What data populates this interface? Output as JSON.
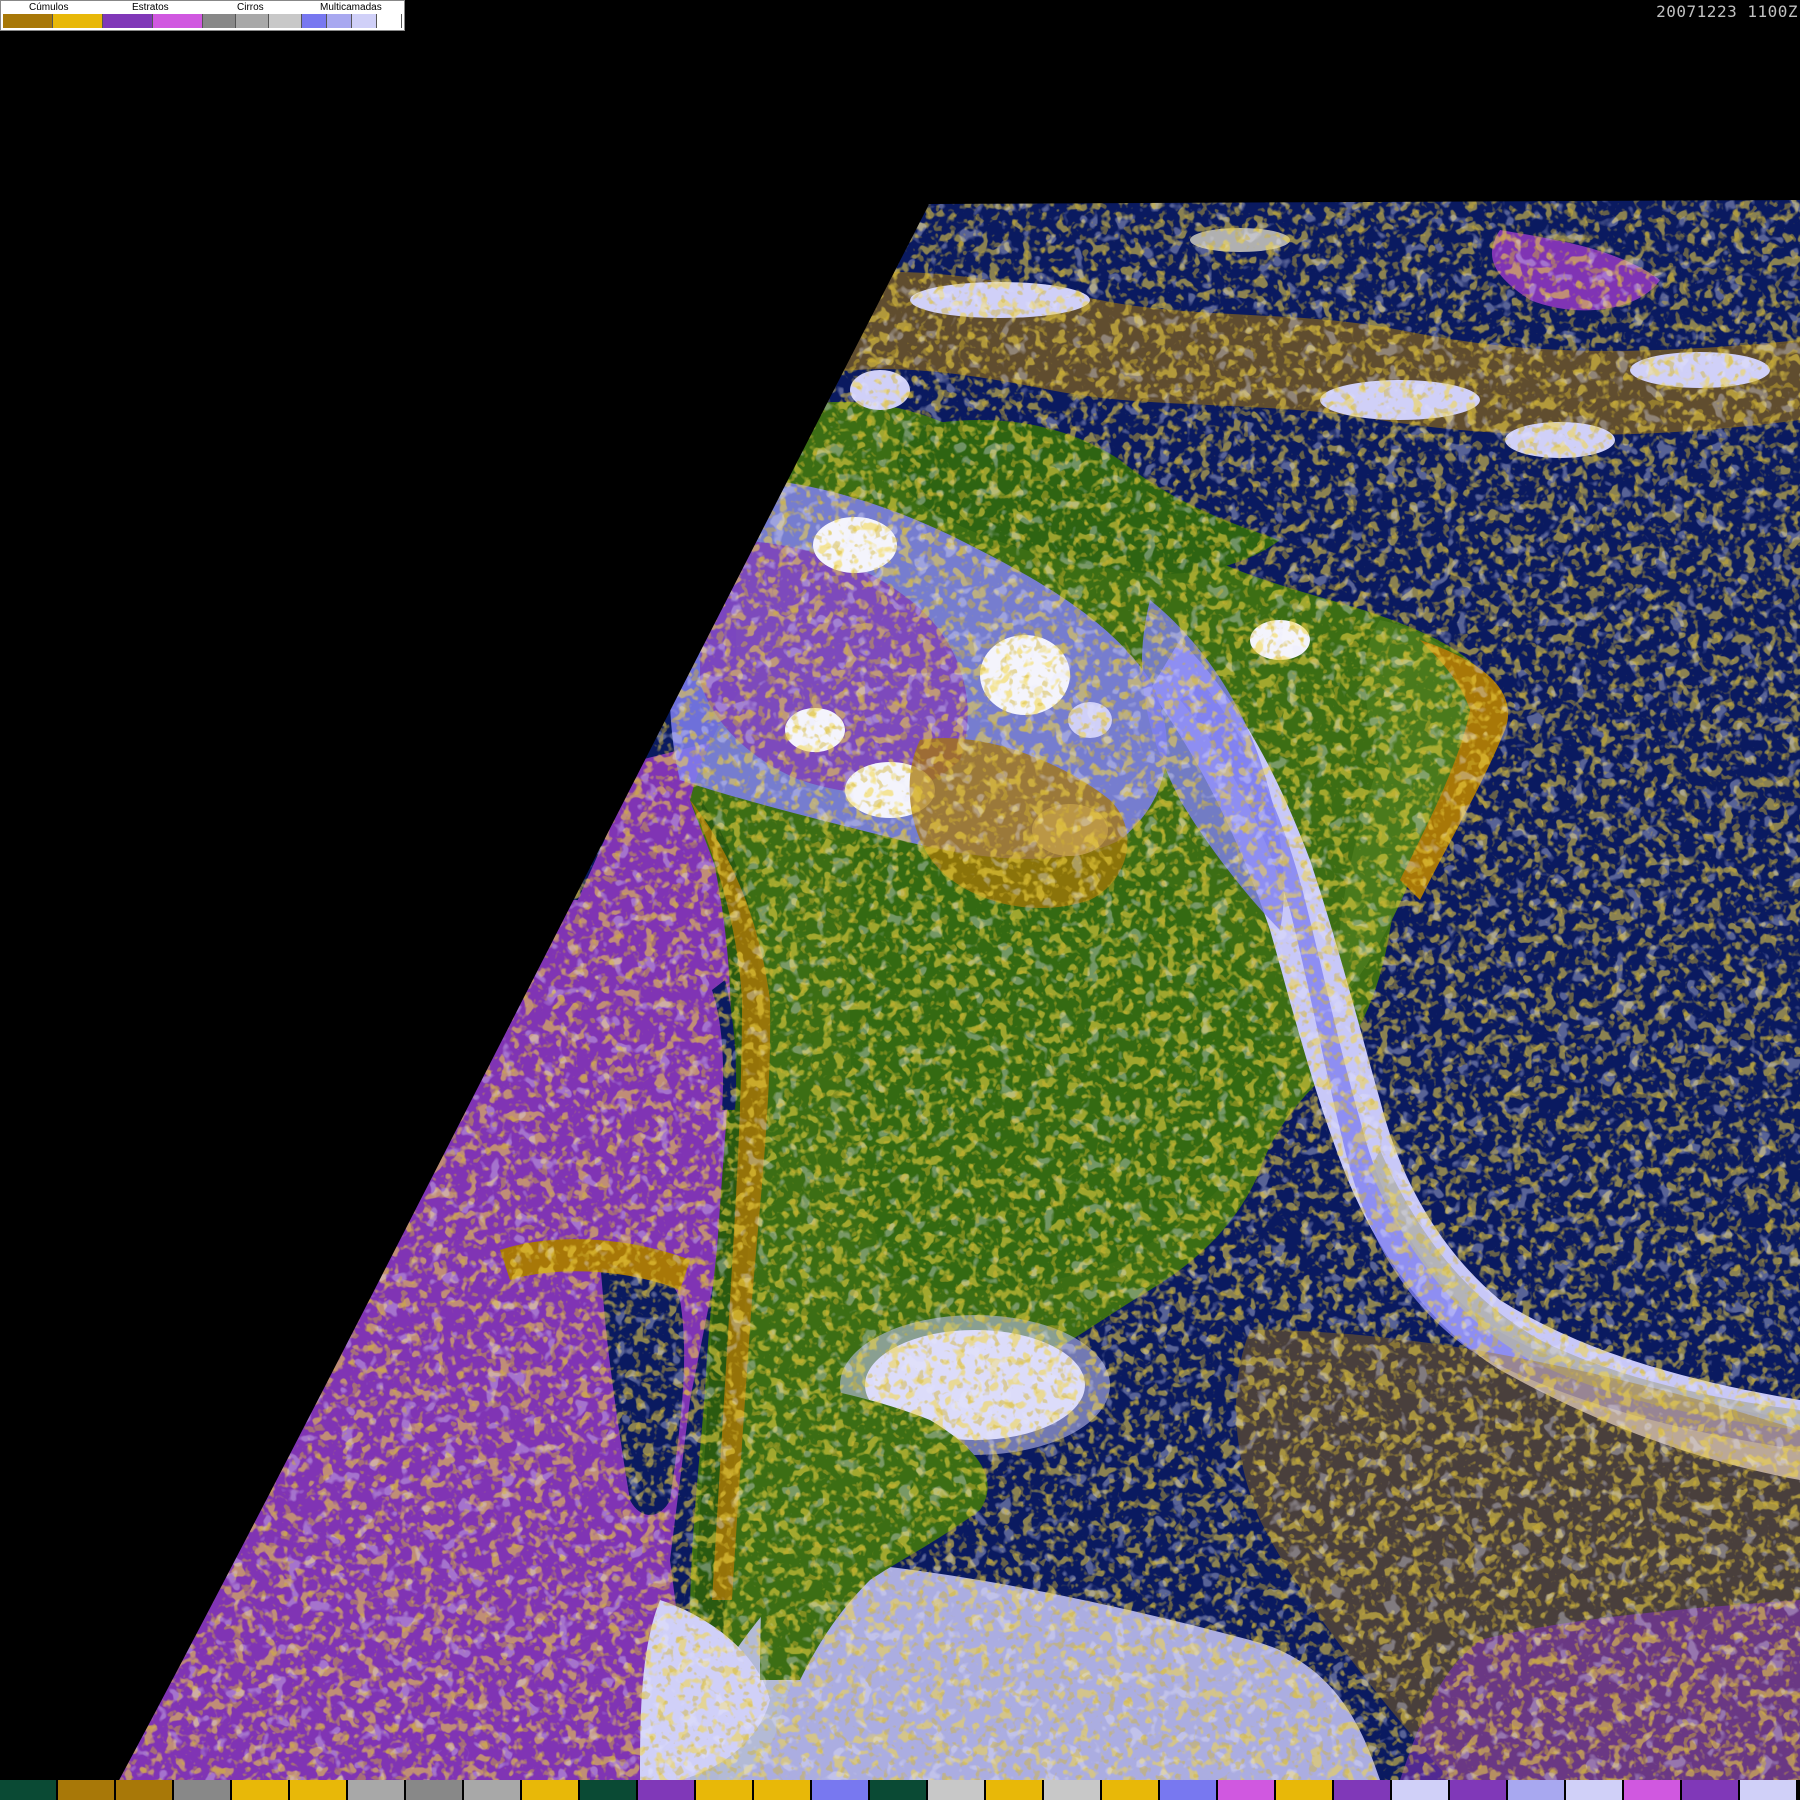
{
  "timestamp": "20071223 1100Z",
  "legend": {
    "labels": [
      "Cúmulos",
      "Estratos",
      "Cirros",
      "Multicamadas"
    ],
    "groups": [
      {
        "name": "Cúmulos",
        "colors": [
          "#a87808",
          "#e8b808"
        ]
      },
      {
        "name": "Estratos",
        "colors": [
          "#8038b8",
          "#d058e0"
        ]
      },
      {
        "name": "Cirros",
        "colors": [
          "#888888",
          "#a8a8a8",
          "#c8c8c8"
        ]
      },
      {
        "name": "Multicamadas",
        "colors": [
          "#7878f0",
          "#a8a8f0",
          "#d0d0f8",
          "#ffffff"
        ]
      }
    ]
  },
  "map_colors": {
    "space": "#000000",
    "ocean": "#0a1a60",
    "land": "#3c6e14",
    "land_dark": "#2a5a10",
    "stratus": "#8034b4",
    "stratus_light": "#d058e0",
    "cumulus": "#a87808",
    "cumulus_light": "#e8b010",
    "multilayer": "#8080f0",
    "multilayer_light": "#c8c8f8",
    "cirrus": "#b0b0b0",
    "white": "#f4f4fc"
  },
  "bottom_strip": [
    "#0a4a34",
    "#a87808",
    "#a87808",
    "#888888",
    "#e8b808",
    "#e8b808",
    "#a8a8a8",
    "#888888",
    "#a8a8a8",
    "#e8b808",
    "#0a4a34",
    "#8038b8",
    "#e8b808",
    "#e8b808",
    "#7878f0",
    "#0a4a34",
    "#c8c8c8",
    "#e8b808",
    "#c8c8c8",
    "#e8b808",
    "#7878f0",
    "#d058e0",
    "#e8b808",
    "#8038b8",
    "#d0d0f8",
    "#8038b8",
    "#a8a8f0",
    "#d0d0f8",
    "#d058e0",
    "#8038b8",
    "#d0d0f8"
  ]
}
